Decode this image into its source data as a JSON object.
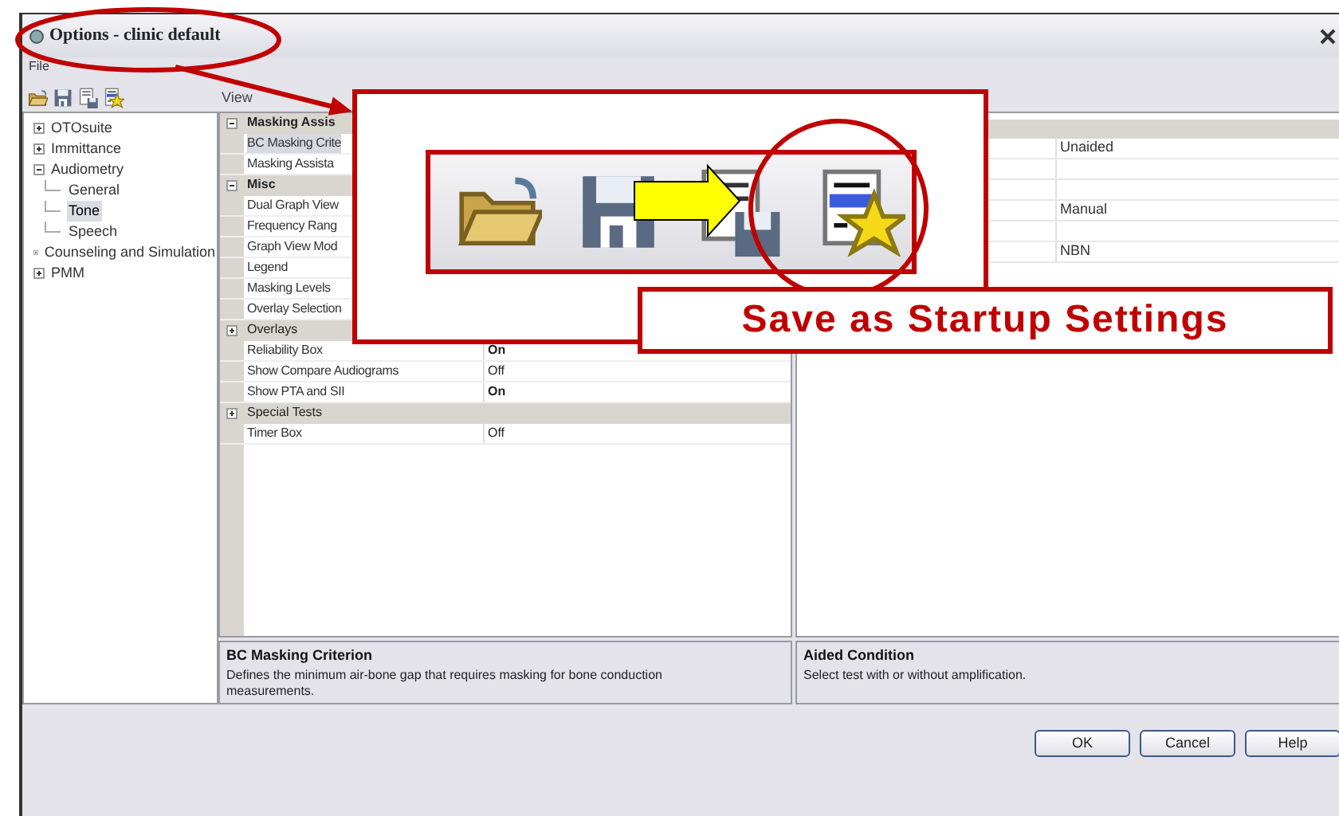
{
  "window": {
    "title": "Options - clinic default"
  },
  "menu": [
    "File"
  ],
  "toolbar": [
    {
      "kind": "open"
    },
    {
      "kind": "save"
    },
    {
      "kind": "save_as"
    },
    {
      "kind": "startup"
    }
  ],
  "tree": [
    {
      "label": "OTOsuite",
      "expanded": false,
      "selected": false
    },
    {
      "label": "Immittance",
      "expanded": false,
      "selected": false
    },
    {
      "label": "Audiometry",
      "expanded": true,
      "selected": false,
      "children": [
        {
          "label": "General",
          "selected": false
        },
        {
          "label": "Tone",
          "selected": true
        },
        {
          "label": "Speech",
          "selected": false
        }
      ]
    },
    {
      "label": "Counseling and Simulation",
      "expanded": false,
      "selected": false
    },
    {
      "label": "PMM",
      "expanded": false,
      "selected": false
    }
  ],
  "grid_header": "View",
  "properties": [
    {
      "kind": "category",
      "label": "Masking Assis",
      "expanded": true
    },
    {
      "kind": "property",
      "label": "BC Masking Crite",
      "selected": true
    },
    {
      "kind": "property",
      "label": "Masking Assista",
      "selected": false
    },
    {
      "kind": "category",
      "label": "Misc",
      "expanded": true
    },
    {
      "kind": "property",
      "label": "Dual Graph View",
      "selected": false
    },
    {
      "kind": "property",
      "label": "Frequency Rang",
      "selected": false
    },
    {
      "kind": "property",
      "label": "Graph View Mod",
      "selected": false
    },
    {
      "kind": "property",
      "label": "Legend",
      "selected": false
    },
    {
      "kind": "property",
      "label": "Masking Levels",
      "selected": false
    },
    {
      "kind": "property",
      "label": "Overlay Selection",
      "selected": false
    },
    {
      "kind": "category",
      "label": "Overlays",
      "expanded": false
    },
    {
      "kind": "property",
      "label": "Reliability Box",
      "value": "On",
      "modified": true,
      "selected": false
    },
    {
      "kind": "property",
      "label": "Show Compare Audiograms",
      "value": "Off",
      "modified": false,
      "selected": false
    },
    {
      "kind": "property",
      "label": "Show PTA and SII",
      "value": "On",
      "modified": true,
      "selected": false
    },
    {
      "kind": "category",
      "label": "Special Tests",
      "expanded": false
    },
    {
      "kind": "property",
      "label": "Timer Box",
      "value": "Off",
      "modified": false,
      "selected": false
    }
  ],
  "right_grid": {
    "rows": [
      {
        "kind": "value",
        "value": "Unaided"
      },
      {
        "kind": "empty"
      },
      {
        "kind": "empty"
      },
      {
        "kind": "value",
        "value": "Manual"
      },
      {
        "kind": "empty"
      },
      {
        "kind": "value",
        "value": "NBN"
      }
    ]
  },
  "descriptions": [
    {
      "title": "BC Masking Criterion",
      "text": "Defines the minimum air-bone gap that requires masking for bone conduction measurements."
    },
    {
      "title": "Aided Condition",
      "text": "Select test with or without amplification."
    }
  ],
  "buttons": [
    "OK",
    "Cancel",
    "Help"
  ],
  "callout": {
    "label": "Save as Startup Settings",
    "icons": [
      {
        "kind": "open"
      },
      {
        "kind": "save"
      },
      {
        "kind": "save_as"
      },
      {
        "kind": "startup"
      }
    ]
  }
}
